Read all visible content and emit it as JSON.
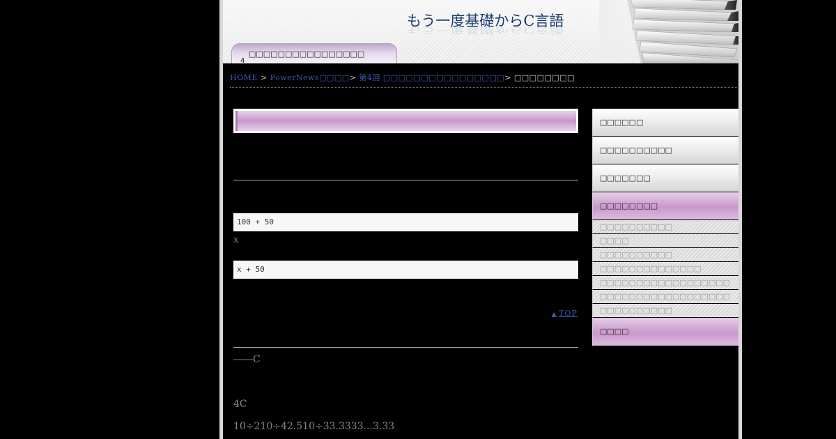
{
  "header": {
    "site_title": "もう一度基礎からC言語",
    "tab_label": "□□□□□□□□□□□□□□□□",
    "tab_number": "4"
  },
  "breadcrumb": {
    "home": "HOME",
    "sep": ">",
    "crumb2": "PowerNews□□□□",
    "crumb3": "第4回 □□□□□□□□□□□□□□□□",
    "current": "□□□□□□□□"
  },
  "main": {
    "code1": "100 + 50",
    "para_x": "x",
    "code2": "x + 50",
    "top_link": "TOP",
    "top_arrow": "▲",
    "text1": "――C",
    "text2": "4C",
    "text3": "10÷210÷42.510÷33.3333...3.33"
  },
  "sidebar": {
    "items": [
      {
        "label": "□□□□□□"
      },
      {
        "label": "□□□□□□□□□□"
      },
      {
        "label": "□□□□□□□"
      },
      {
        "label": "□□□□□□□□"
      }
    ],
    "sub_items": [
      {
        "label": "□□□□□□□□□□"
      },
      {
        "label": "□□□□"
      },
      {
        "label": "□□□□□□□□□□"
      },
      {
        "label": "□□□□□□□□□□□□□□"
      },
      {
        "label": "□□□□□□□□□□□□□□□□□□"
      },
      {
        "label": "□□□□□□□□□□□□□□□□□□"
      },
      {
        "label": "□□□□□□□□□□"
      }
    ],
    "last_item": {
      "label": "□□□□"
    }
  }
}
